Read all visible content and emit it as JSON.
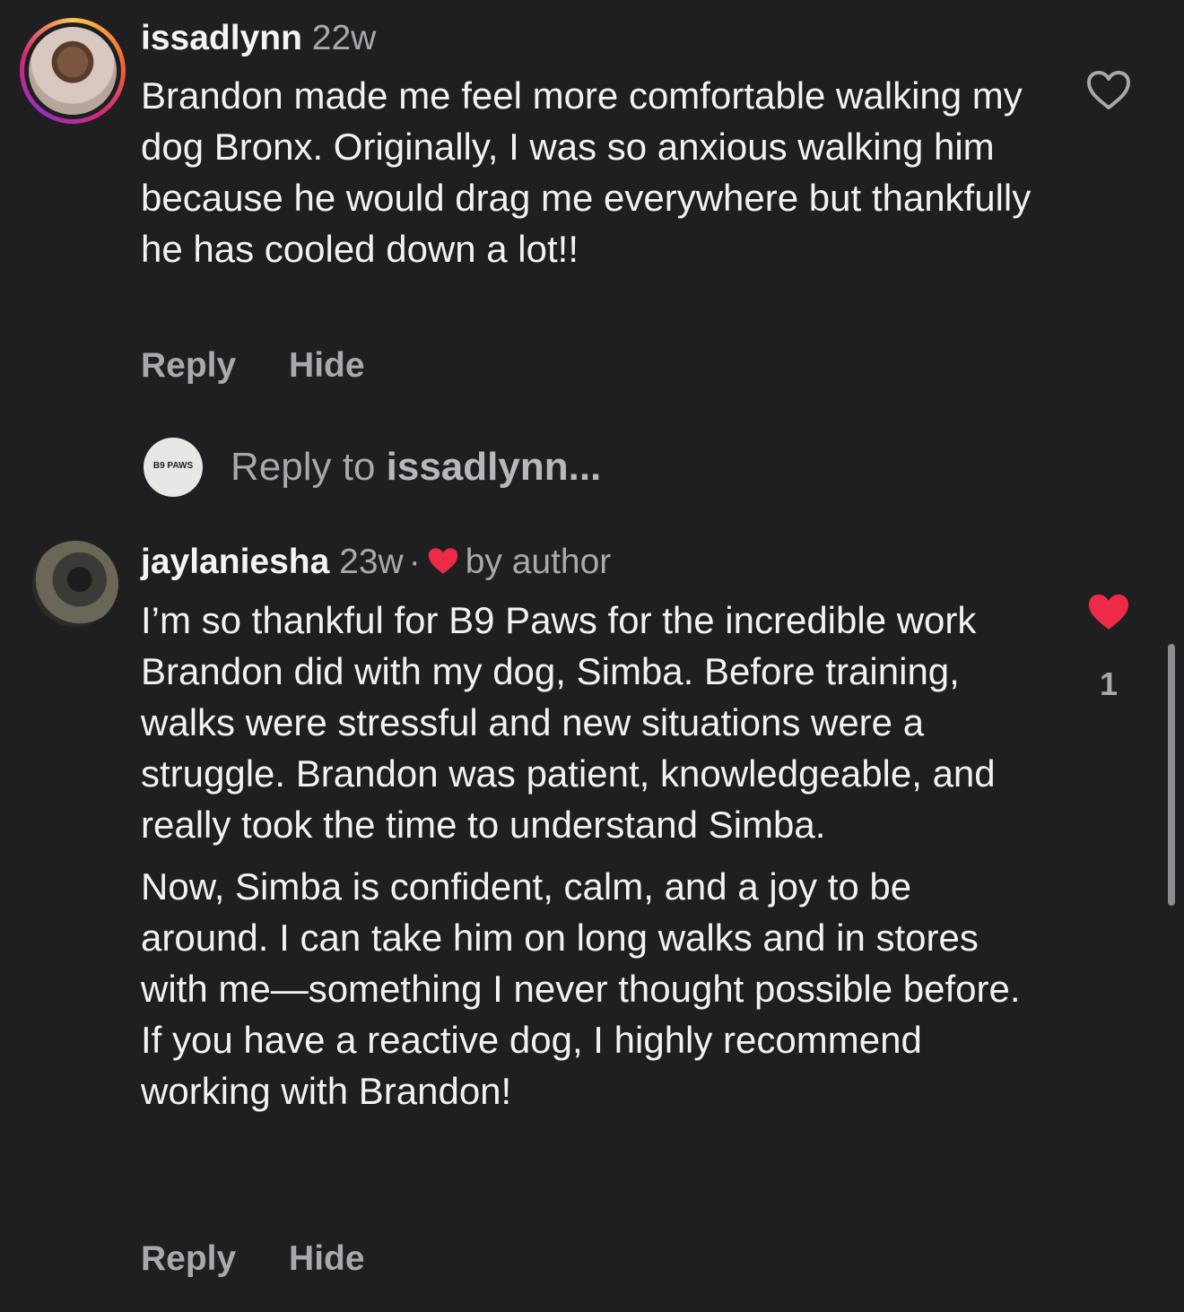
{
  "comments": [
    {
      "username": "issadlynn",
      "time": "22w",
      "text": [
        "Brandon made me feel more comfortable walking my dog Bronx.  Originally, I was so anxious walking him because he would drag me everywhere but thankfully he has cooled down a lot!!"
      ],
      "liked": false,
      "like_icon": "heart-outline-icon",
      "actions": {
        "reply": "Reply",
        "hide": "Hide"
      }
    },
    {
      "username": "jaylaniesha",
      "time": "23w",
      "separator": "·",
      "author_badge": "by author",
      "text": [
        "I’m so thankful for B9 Paws for the incredible work Brandon did with my dog, Simba. Before training, walks were stressful and new situations were a struggle. Brandon was patient, knowledgeable, and really took the time to understand Simba.",
        "Now, Simba is confident, calm, and a joy to be around. I can take him on long walks and in stores with me—something I never thought possible before. If you have a reactive dog, I highly recommend working with Brandon!"
      ],
      "liked": true,
      "like_icon": "heart-filled-icon",
      "like_count": "1",
      "actions": {
        "reply": "Reply",
        "hide": "Hide"
      }
    }
  ],
  "reply_prompt": {
    "prefix": "Reply to ",
    "target": "issadlynn...",
    "logo_text": "B9 PAWS"
  },
  "colors": {
    "background": "#1f1f22",
    "text": "#f2f2f2",
    "muted": "#a8a8ad",
    "heart_red": "#ed2b49"
  }
}
